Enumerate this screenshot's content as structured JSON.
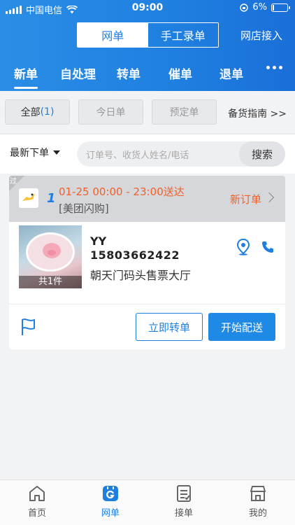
{
  "statusbar": {
    "carrier": "中国电信",
    "time": "09:00",
    "battery": "6%"
  },
  "header": {
    "seg_online": "网单",
    "seg_manual": "手工录单",
    "shop_access": "网店接入"
  },
  "tabs": [
    {
      "label": "新单",
      "active": true
    },
    {
      "label": "自处理"
    },
    {
      "label": "转单",
      "dot": true
    },
    {
      "label": "催单"
    },
    {
      "label": "退单"
    }
  ],
  "filters": {
    "all_label": "全部",
    "all_count": "(1)",
    "today": "今日单",
    "reserved": "预定单",
    "guide": "备货指南 >>"
  },
  "search": {
    "sort_label": "最新下单",
    "placeholder": "订单号、收货人姓名/电话",
    "button": "搜索"
  },
  "order": {
    "expired_tag": "过",
    "seq": "1",
    "deliver_time": "01-25 00:00 - 23:00送达",
    "channel": "[美团闪购]",
    "status": "新订单",
    "quantity": "共1件",
    "customer_name": "YY",
    "customer_phone": "15803662422",
    "address": "朝天门码头售票大厅",
    "btn_transfer": "立即转单",
    "btn_deliver": "开始配送"
  },
  "nav": [
    {
      "label": "首页",
      "icon": "home-icon"
    },
    {
      "label": "网单",
      "icon": "online-order-icon",
      "active": true
    },
    {
      "label": "接单",
      "icon": "accept-order-icon"
    },
    {
      "label": "我的",
      "icon": "store-icon"
    }
  ],
  "colors": {
    "brand": "#1f7fe0",
    "accent": "#f0612a"
  }
}
